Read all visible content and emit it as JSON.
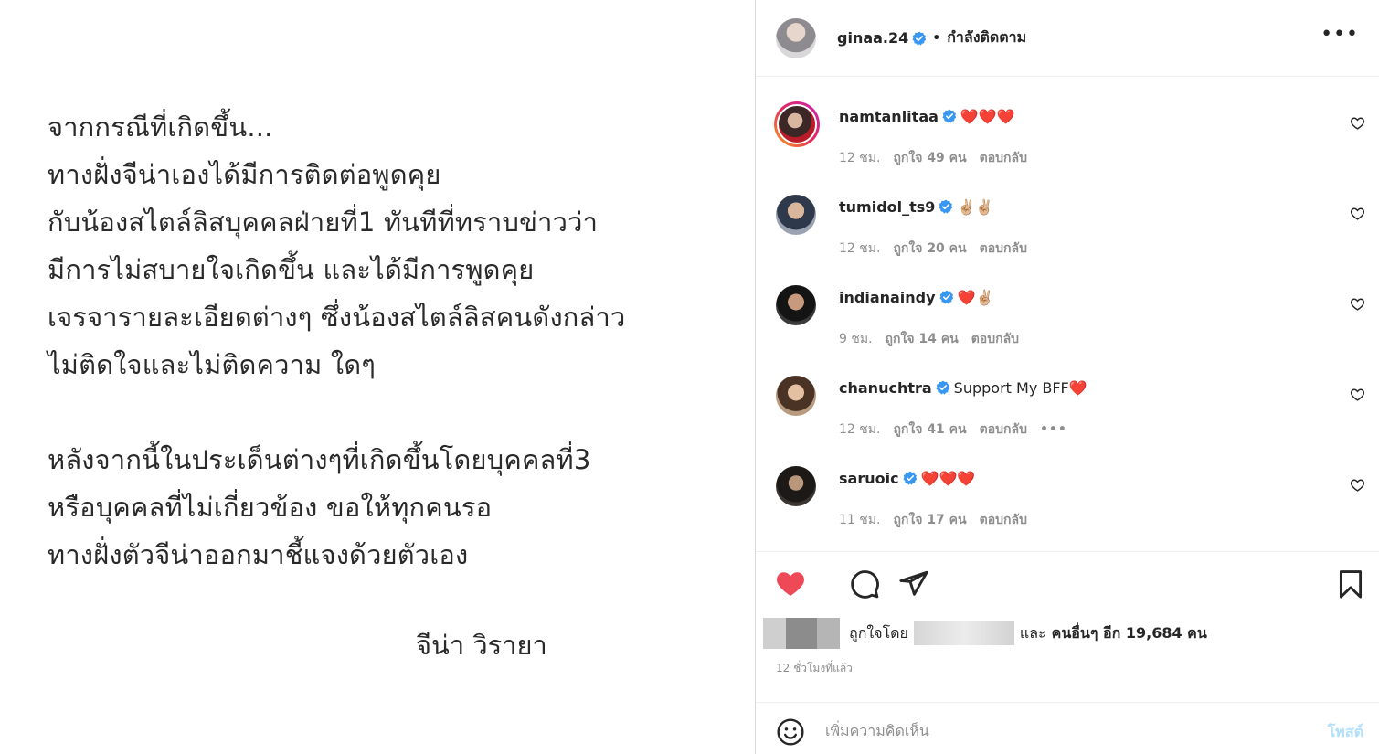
{
  "post_image": {
    "lines": [
      "จากกรณีที่เกิดขึ้น...",
      "ทางฝั่งจีน่าเองได้มีการติดต่อพูดคุย",
      "กับน้องสไตล์ลิสบุคคลฝ่ายที่1 ทันทีที่ทราบข่าวว่า",
      "มีการไม่สบายใจเกิดขึ้น และได้มีการพูดคุย",
      "เจรจารายละเอียดต่างๆ ซึ่งน้องสไตล์ลิสคนดังกล่าว",
      "ไม่ติดใจและไม่ติดความ ใดๆ",
      "",
      "หลังจากนี้ในประเด็นต่างๆที่เกิดขึ้นโดยบุคคลที่3",
      "หรือบุคคลที่ไม่เกี่ยวข้อง ขอให้ทุกคนรอ",
      "ทางฝั่งตัวจีน่าออกมาชี้แจงด้วยตัวเอง"
    ],
    "signature": "จีน่า วิรายา"
  },
  "header": {
    "username": "ginaa.24",
    "separator": "•",
    "follow_status": "กำลังติดตาม",
    "more": "•••"
  },
  "comments": [
    {
      "username": "namtanlitaa",
      "text": "❤️❤️❤️",
      "time": "12 ชม.",
      "likes": "ถูกใจ 49 คน",
      "reply": "ตอบกลับ",
      "more": ""
    },
    {
      "username": "tumidol_ts9",
      "text": "✌🏼✌🏼",
      "time": "12 ชม.",
      "likes": "ถูกใจ 20 คน",
      "reply": "ตอบกลับ",
      "more": ""
    },
    {
      "username": "indianaindy",
      "text": "❤️✌🏼",
      "time": "9 ชม.",
      "likes": "ถูกใจ 14 คน",
      "reply": "ตอบกลับ",
      "more": ""
    },
    {
      "username": "chanuchtra",
      "text": "Support My BFF❤️",
      "time": "12 ชม.",
      "likes": "ถูกใจ 41 คน",
      "reply": "ตอบกลับ",
      "more": "•••"
    },
    {
      "username": "saruoic",
      "text": "❤️❤️❤️",
      "time": "11 ชม.",
      "likes": "ถูกใจ 17 คน",
      "reply": "ตอบกลับ",
      "more": ""
    }
  ],
  "likes": {
    "prefix": "ถูกใจโดย",
    "and": "และ",
    "others": "คนอื่นๆ อีก 19,684 คน"
  },
  "posted_time": "12 ชั่วโมงที่แล้ว",
  "add_comment": {
    "placeholder": "เพิ่มความคิดเห็น",
    "post_label": "โพสต์"
  },
  "colors": {
    "like_red": "#ed4956",
    "verified_blue": "#3897f0",
    "post_button_disabled": "#b2dffc",
    "muted_text": "#8e8e8e"
  },
  "icons": {
    "like": "heart-filled-icon",
    "comment": "speech-bubble-icon",
    "share": "paper-plane-icon",
    "save": "bookmark-icon",
    "emoji": "smiley-icon",
    "comment_like": "heart-outline-icon",
    "verified": "verified-badge-icon"
  }
}
